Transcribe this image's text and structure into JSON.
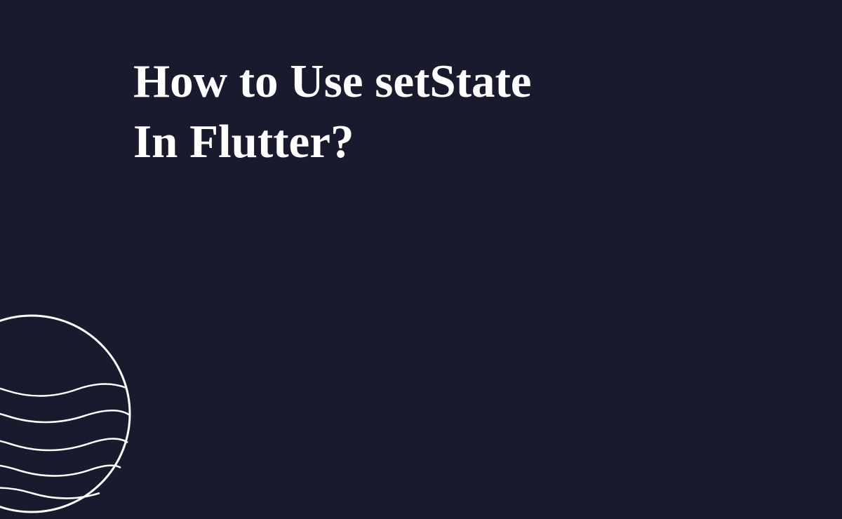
{
  "title_line1": "How to Use setState",
  "title_line2": "In Flutter?",
  "colors": {
    "background": "#1a1a2e",
    "text": "#ffffff",
    "stroke": "#ffffff"
  }
}
